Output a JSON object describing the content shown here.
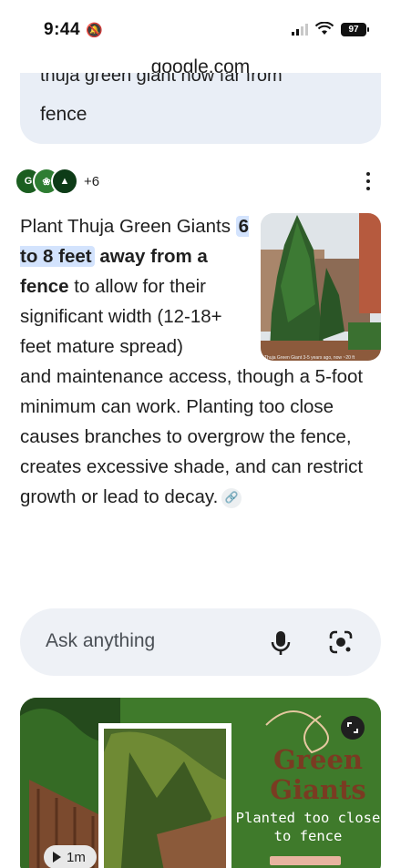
{
  "status_bar": {
    "time": "9:44",
    "battery": "97"
  },
  "browser": {
    "url": "google.com"
  },
  "previous_query": {
    "cut_text": "thuja green giant how far from",
    "last_line": "fence"
  },
  "sources": {
    "extra_count": "+6"
  },
  "answer": {
    "line1": "Plant Thuja Green",
    "giants": "Giants ",
    "highlight": "6 to 8 feet",
    "bold_tail": "away from a fence",
    "after_bold": " to",
    "narrow_rest": "allow for their significant width (12-18+ feet mature spread)",
    "full_rest": "and maintenance access, though a 5-foot minimum can work. Planting too close causes branches to overgrow the fence, creates excessive shade, and can restrict growth or lead to decay."
  },
  "answer_image": {
    "caption": "Thuja Green Giant 3-5 years ago, now ~20 ft"
  },
  "ask_box": {
    "placeholder": "Ask anything"
  },
  "video": {
    "title": "Green Giants",
    "subtitle": "Planted too close to fence",
    "duration": "1m"
  },
  "colors": {
    "highlight": "#d3e3fd",
    "ask_box_bg": "#eef1f6",
    "video_green": "#3f7a2b",
    "title_brown": "#7a3b22"
  }
}
